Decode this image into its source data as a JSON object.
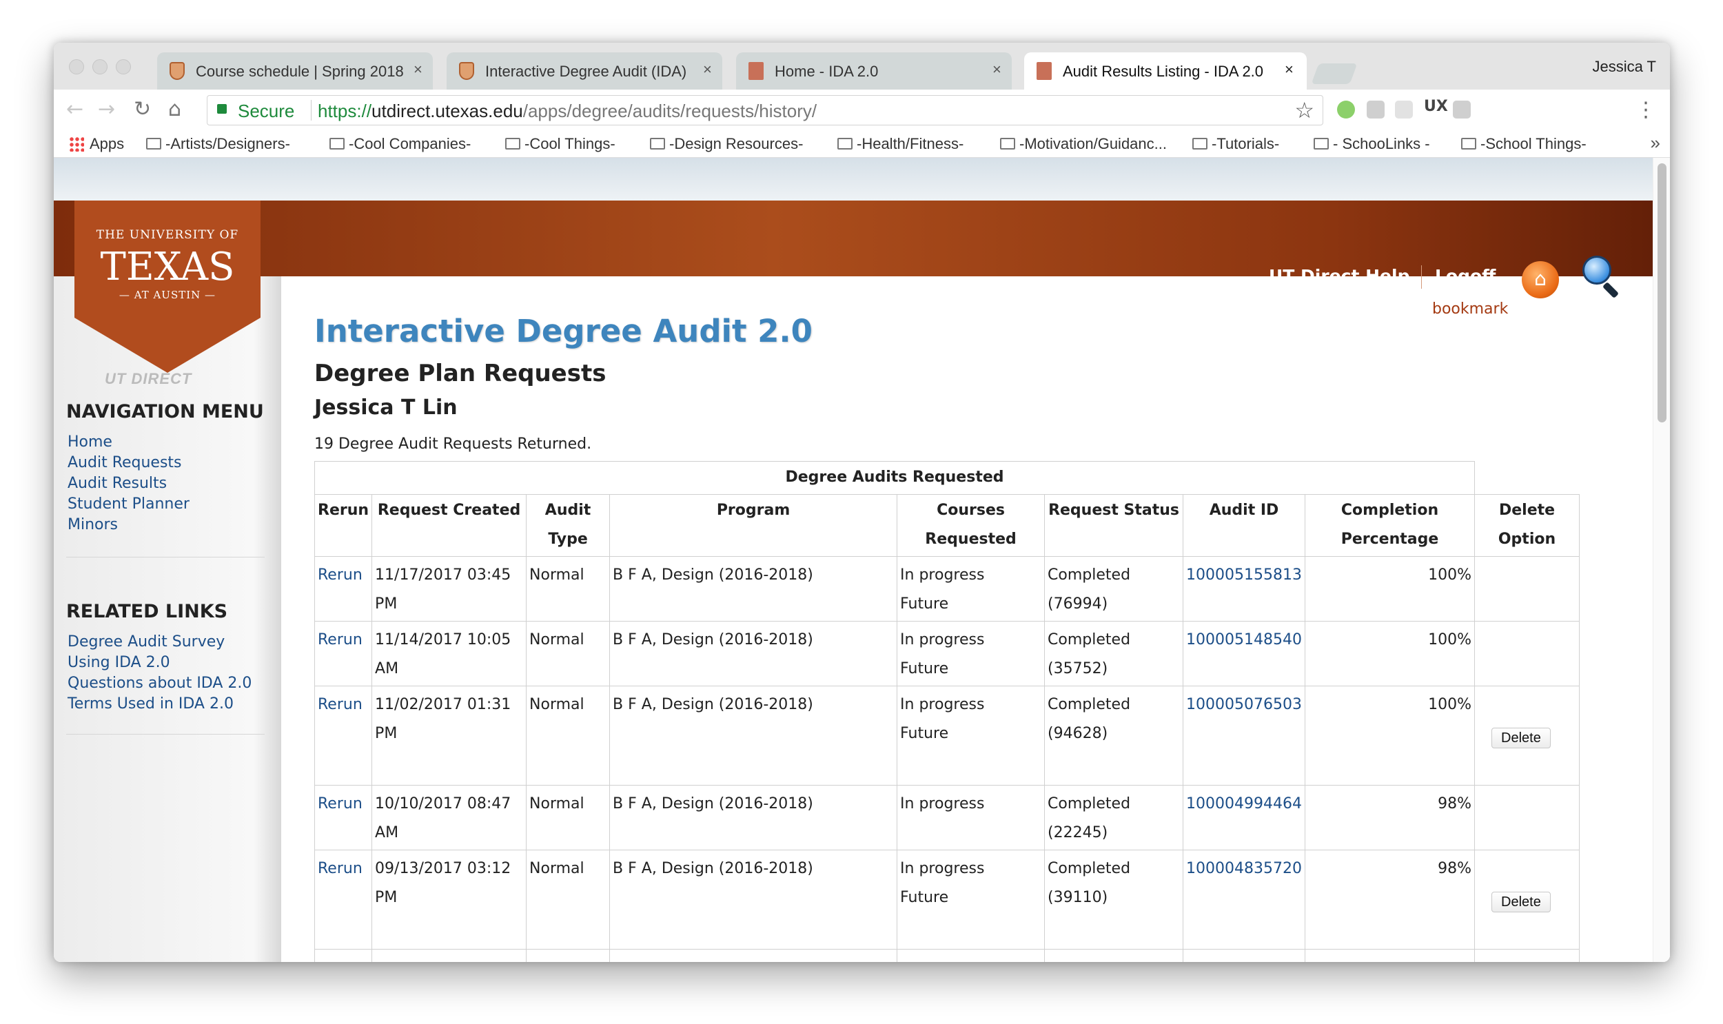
{
  "browser": {
    "profile_name": "Jessica T",
    "tabs": [
      {
        "title": "Course schedule | Spring 2018",
        "favicon": "ut-shield-icon",
        "close": "×"
      },
      {
        "title": "Interactive Degree Audit (IDA)",
        "favicon": "ut-shield-icon",
        "close": "×"
      },
      {
        "title": "Home - IDA 2.0",
        "favicon": "ut-tower-icon",
        "close": "×"
      },
      {
        "title": "Audit Results Listing - IDA 2.0",
        "favicon": "ut-tower-icon",
        "close": "×",
        "active": true
      }
    ],
    "nav": {
      "back": "←",
      "forward": "→",
      "reload": "↻",
      "home": "⌂"
    },
    "address": {
      "secure_label": "Secure",
      "scheme": "https://",
      "host": "utdirect.utexas.edu",
      "path": "/apps/degree/audits/requests/history/"
    },
    "star": "☆",
    "ext_ux": "UX",
    "menu": "⋮",
    "bookmarks_more": "»",
    "bookmarks": [
      "Apps",
      "-Artists/Designers-",
      "-Cool Companies-",
      "-Cool Things-",
      "-Design Resources-",
      "-Health/Fitness-",
      "-Motivation/Guidanc...",
      "-Tutorials-",
      "- SchooLinks -",
      "-School Things-"
    ]
  },
  "site": {
    "logo_top": "THE UNIVERSITY OF",
    "logo_main": "TEXAS",
    "logo_bottom": "— AT AUSTIN —",
    "utdirect": "UT DIRECT",
    "help": "UT Direct Help",
    "logoff": "Logoff",
    "home_glyph": "⌂",
    "bookmark": "bookmark",
    "accent": "#3e85bd",
    "header_color": "#a5451a"
  },
  "sidebar": {
    "nav_title": "NAVIGATION MENU",
    "nav_items": [
      "Home",
      "Audit Requests",
      "Audit Results",
      "Student Planner",
      "Minors"
    ],
    "related_title": "RELATED LINKS",
    "related_items": [
      "Degree Audit Survey",
      "Using IDA 2.0",
      "Questions about IDA 2.0",
      "Terms Used in IDA 2.0"
    ]
  },
  "main": {
    "title": "Interactive Degree Audit 2.0",
    "subtitle": "Degree Plan Requests",
    "user": "Jessica T Lin",
    "count_text": "19 Degree Audit Requests Returned.",
    "table": {
      "caption": "Degree Audits Requested",
      "headers": {
        "rerun": "Rerun",
        "created": "Request Created",
        "type": [
          "Audit",
          "Type"
        ],
        "program": "Program",
        "courses": [
          "Courses",
          "Requested"
        ],
        "status": "Request Status",
        "audit_id": "Audit ID",
        "completion": [
          "Completion",
          "Percentage"
        ],
        "delete": [
          "Delete",
          "Option"
        ]
      },
      "rows": [
        {
          "rerun": "Rerun",
          "created": [
            "11/17/2017 03:45",
            "PM"
          ],
          "type": "Normal",
          "program": "B F A, Design (2016-2018)",
          "courses": [
            "In progress",
            "Future"
          ],
          "status": [
            "Completed",
            "(76994)"
          ],
          "audit_id": "100005155813",
          "completion": "100%",
          "delete": ""
        },
        {
          "rerun": "Rerun",
          "created": [
            "11/14/2017 10:05",
            "AM"
          ],
          "type": "Normal",
          "program": "B F A, Design (2016-2018)",
          "courses": [
            "In progress",
            "Future"
          ],
          "status": [
            "Completed",
            "(35752)"
          ],
          "audit_id": "100005148540",
          "completion": "100%",
          "delete": ""
        },
        {
          "rerun": "Rerun",
          "created": [
            "11/02/2017 01:31",
            "PM"
          ],
          "type": "Normal",
          "program": "B F A, Design (2016-2018)",
          "courses": [
            "In progress",
            "Future"
          ],
          "status": [
            "Completed",
            "(94628)"
          ],
          "audit_id": "100005076503",
          "completion": "100%",
          "delete": "Delete"
        },
        {
          "rerun": "Rerun",
          "created": [
            "10/10/2017 08:47",
            "AM"
          ],
          "type": "Normal",
          "program": "B F A, Design (2016-2018)",
          "courses": [
            "In progress",
            ""
          ],
          "status": [
            "Completed",
            "(22245)"
          ],
          "audit_id": "100004994464",
          "completion": "98%",
          "delete": ""
        },
        {
          "rerun": "Rerun",
          "created": [
            "09/13/2017 03:12",
            "PM"
          ],
          "type": "Normal",
          "program": "B F A, Design (2016-2018)",
          "courses": [
            "In progress",
            "Future"
          ],
          "status": [
            "Completed",
            "(39110)"
          ],
          "audit_id": "100004835720",
          "completion": "98%",
          "delete": "Delete"
        }
      ]
    }
  }
}
